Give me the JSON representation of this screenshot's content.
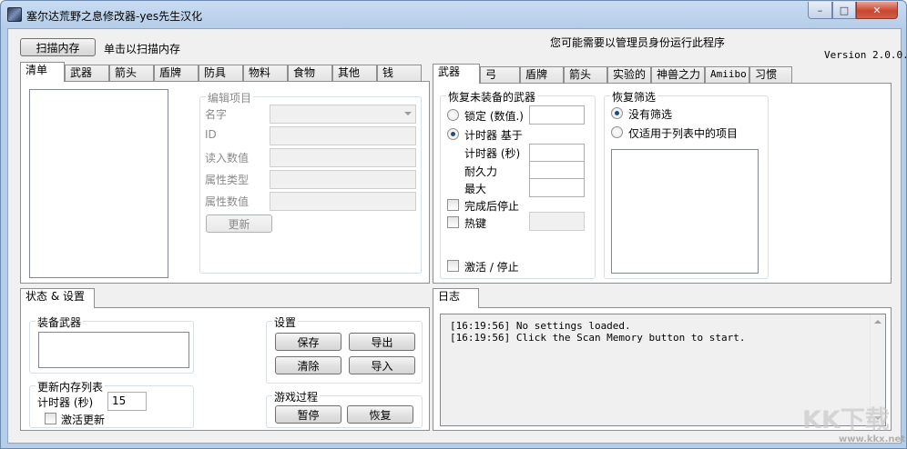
{
  "window": {
    "title": "塞尔达荒野之息修改器-yes先生汉化",
    "min_label": "–",
    "max_label": "□",
    "close_label": "✕"
  },
  "top": {
    "scan_button": "扫描内存",
    "scan_hint": "单击以扫描内存",
    "admin_notice": "您可能需要以管理员身份运行此程序",
    "version": "Version 2.0.0."
  },
  "inventory": {
    "tabs": [
      "清单",
      "武器",
      "箭头",
      "盾牌",
      "防具",
      "物料",
      "食物",
      "其他",
      "钱"
    ],
    "edit_group_title": "编辑项目",
    "fields": {
      "name": "名字",
      "id": "ID",
      "read_value": "读入数值",
      "attr_type": "属性类型",
      "attr_value": "属性数值"
    },
    "update_button": "更新"
  },
  "weapons_panel": {
    "tabs": [
      "武器",
      "弓",
      "盾牌",
      "箭头",
      "实验的",
      "神兽之力",
      "Amiibo",
      "习惯"
    ],
    "restore_group_title": "恢复未装备的武器",
    "lock_label": "锁定 (数值.)",
    "timer_based_label": "计时器 基于",
    "timer_seconds_label": "计时器 (秒)",
    "durability_label": "耐久力",
    "max_label": "最大",
    "stop_when_done_label": "完成后停止",
    "hotkey_label": "热键",
    "activate_label": "激活 / 停止",
    "filter_group_title": "恢复筛选",
    "no_filter_label": "没有筛选",
    "only_list_label": "仅适用于列表中的项目"
  },
  "status_panel": {
    "tab": "状态 & 设置",
    "equipped_group_title": "装备武器",
    "refresh_group_title": "更新内存列表",
    "timer_label": "计时器 (秒)",
    "timer_value": "15",
    "auto_refresh_label": "激活更新",
    "settings_group_title": "设置",
    "save_button": "保存",
    "export_button": "导出",
    "clear_button": "清除",
    "import_button": "导入",
    "game_process_group_title": "游戏过程",
    "pause_button": "暂停",
    "resume_button": "恢复"
  },
  "log_panel": {
    "tab": "日志",
    "lines": [
      "[16:19:56] No settings loaded.",
      "[16:19:56] Click the Scan Memory button to start."
    ]
  },
  "watermark": {
    "text": "KK下载",
    "url": "www.kkx.net"
  }
}
